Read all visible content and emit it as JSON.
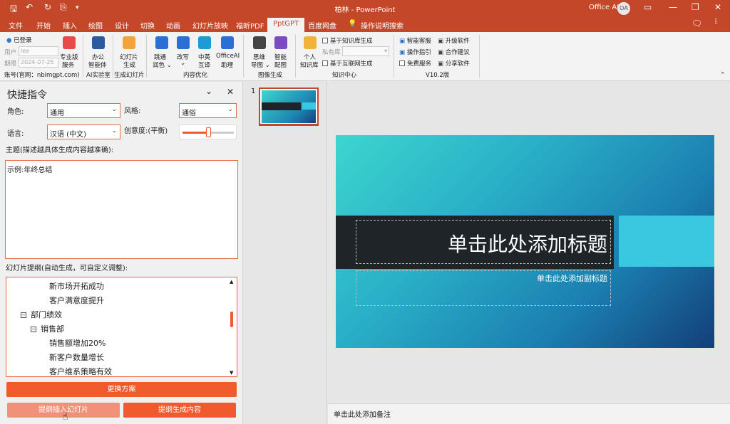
{
  "titlebar": {
    "title": "柏林 - PowerPoint",
    "officeai": "Office AI",
    "avatar": "OA"
  },
  "menu": [
    "文件",
    "开始",
    "插入",
    "绘图",
    "设计",
    "切换",
    "动画",
    "幻灯片放映",
    "福昕PDF",
    "PptGPT",
    "百度网盘",
    "操作说明搜索"
  ],
  "ribbon": {
    "login": "已登录",
    "user_label": "用户",
    "user_value": "lee",
    "expire_label": "期限",
    "expire_value": "2024-07-25",
    "account": "账号(官网：nbimgpt.com)",
    "pro_service": [
      "专业版",
      "服务"
    ],
    "office_agent": [
      "办公",
      "智能体"
    ],
    "ai_lab": "AI实验室",
    "gen_slides": [
      "幻灯片",
      "生成"
    ],
    "gen_slides_group": "生成幻灯片",
    "polish": [
      "跳通",
      "润色"
    ],
    "rewrite": [
      "改写"
    ],
    "translate": [
      "中英",
      "互译"
    ],
    "officeai_assist": [
      "OfficeAI",
      "助理"
    ],
    "content_group": "内容优化",
    "mindmap": [
      "思维",
      "导图"
    ],
    "smart_image": [
      "智能",
      "配图"
    ],
    "image_group": "图像生成",
    "personal_kb": [
      "个人",
      "知识库"
    ],
    "kb_gen": "基于知识库生成",
    "private_kb": "私有库",
    "web_gen": "基于互联网生成",
    "kb_group": "知识中心",
    "support": "智能客服",
    "guide": "操作指引",
    "free": "免费服务",
    "upgrade": "升级软件",
    "coop": "合作建议",
    "share": "分享软件",
    "version": "V10.2版"
  },
  "panel": {
    "title": "快捷指令",
    "role_label": "角色:",
    "role_value": "通用",
    "style_label": "风格:",
    "style_value": "通俗",
    "lang_label": "语言:",
    "lang_value": "汉语 (中文)",
    "creativity_label": "创意度:(平衡)",
    "creativity_level": 0.5,
    "topic_label": "主题(描述越具体生成内容越准确):",
    "topic_value": "示例:年终总结",
    "outline_label": "幻灯片提纲(自动生成，可自定义调整):",
    "outline": [
      {
        "text": "新市场开拓成功",
        "level": 3,
        "pm": ""
      },
      {
        "text": "客户满意度提升",
        "level": 3,
        "pm": ""
      },
      {
        "text": "部门绩效",
        "level": 1,
        "pm": "⊟"
      },
      {
        "text": "销售部",
        "level": 2,
        "pm": "⊟"
      },
      {
        "text": "销售额增加20%",
        "level": 3,
        "pm": ""
      },
      {
        "text": "新客户数量增长",
        "level": 3,
        "pm": ""
      },
      {
        "text": "客户维系策略有效",
        "level": 3,
        "pm": ""
      }
    ],
    "btn_change": "更换方案",
    "btn_insert": "提纲插入幻灯片",
    "btn_generate": "提纲生成内容"
  },
  "thumb": {
    "number": "1"
  },
  "slide": {
    "title": "单击此处添加标题",
    "subtitle": "单击此处添加副标题"
  },
  "notes": "单击此处添加备注"
}
